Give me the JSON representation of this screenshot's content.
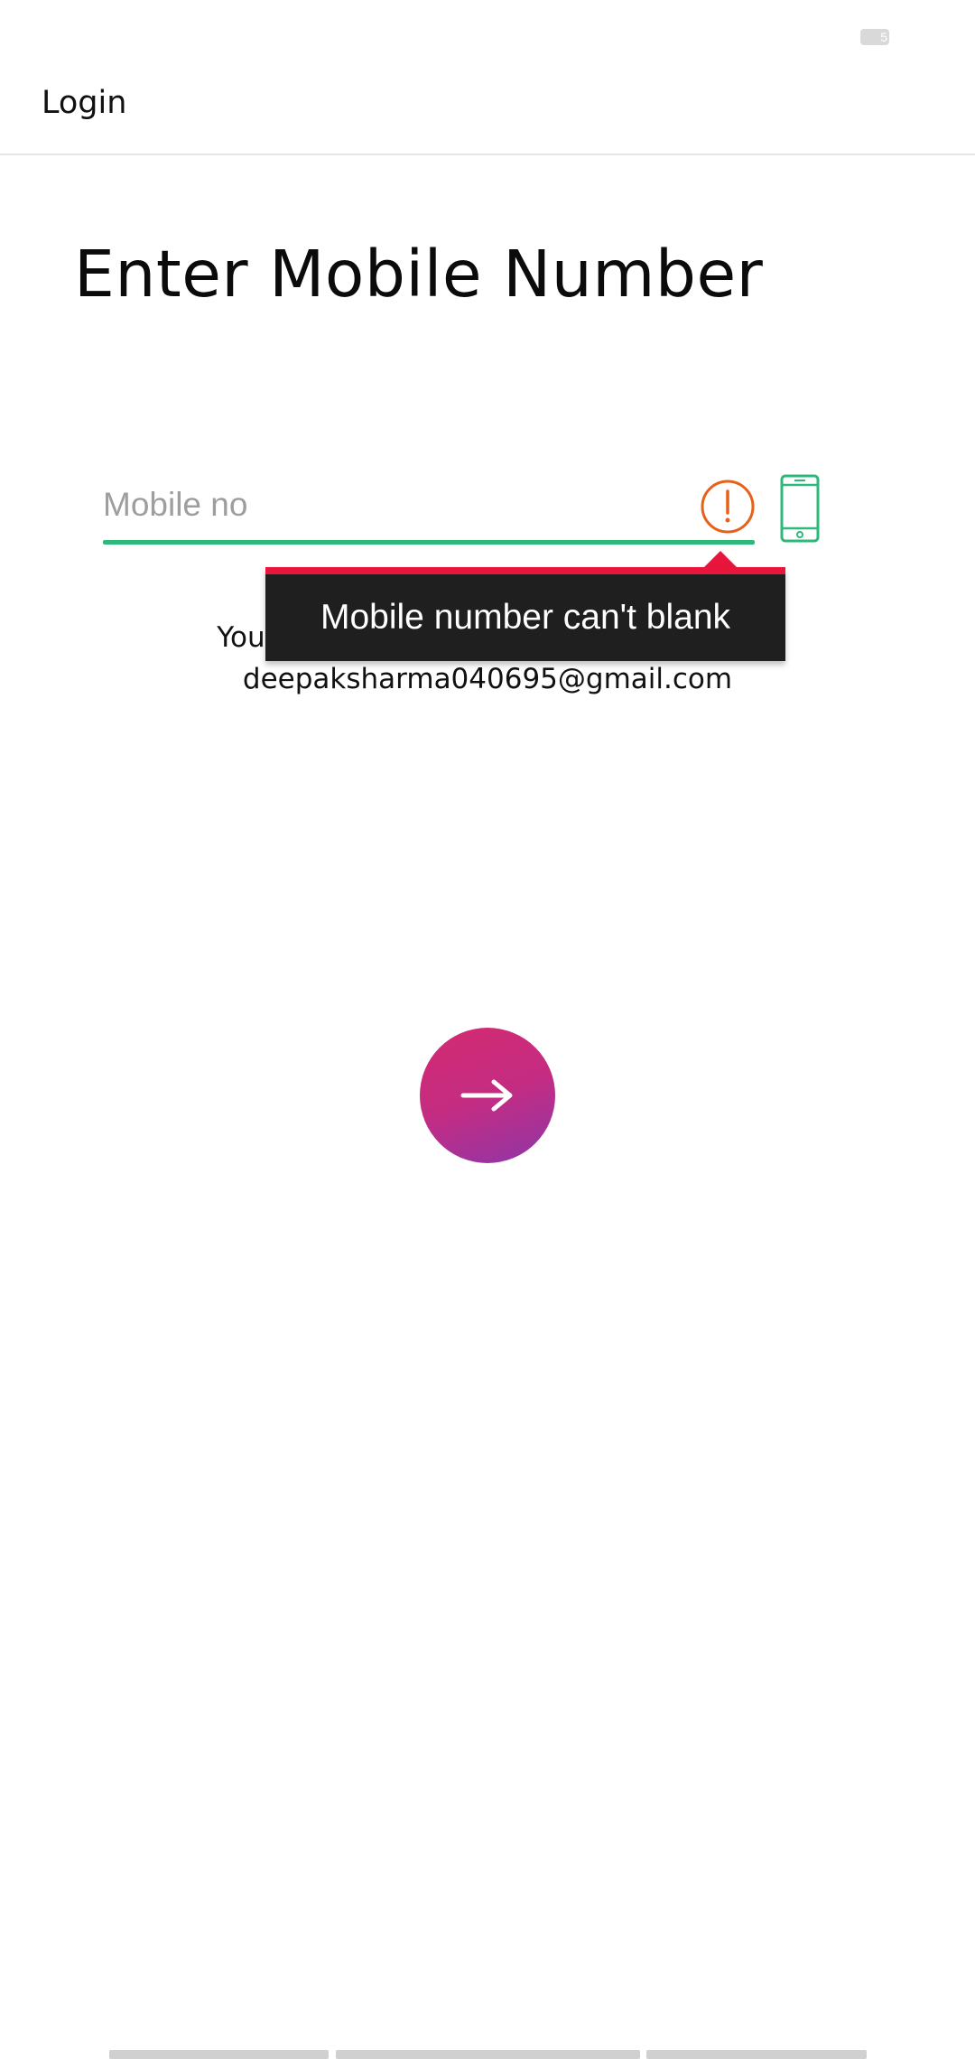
{
  "status_bar": {
    "battery_text": "5"
  },
  "app_bar": {
    "title": "Login"
  },
  "headline": "Enter Mobile Number",
  "mobile_input": {
    "placeholder": "Mobile no",
    "value": ""
  },
  "error_tooltip": {
    "message": "Mobile number can't blank"
  },
  "info": {
    "line1": "Your mobile number will be linked with",
    "email": "deepaksharma040695@gmail.com"
  },
  "colors": {
    "accent_green": "#2fb87b",
    "error_orange": "#e8611a",
    "error_red": "#e8163c",
    "button_gradient_start": "#d42a70",
    "button_gradient_end": "#8f36a8"
  },
  "icons": {
    "error": "error-exclamation-icon",
    "phone": "mobile-phone-icon",
    "next": "arrow-right-icon"
  }
}
